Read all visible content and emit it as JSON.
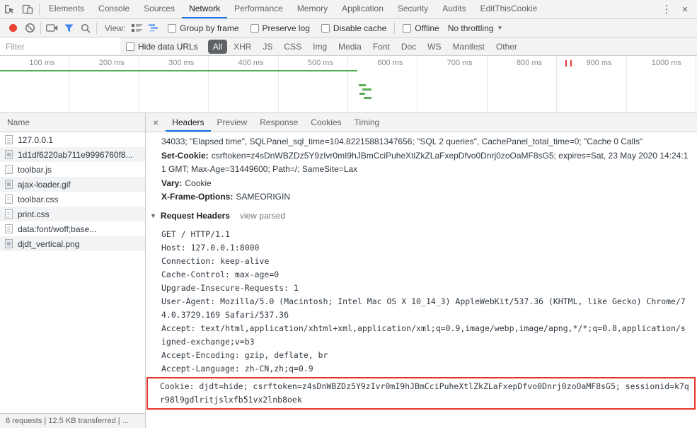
{
  "icons": {
    "more": "⋮",
    "close": "×",
    "caret": "▼",
    "disclosure": "▼",
    "detail_close": "×"
  },
  "colors": {
    "accent_blue": "#1a73e8",
    "record_red": "#ea4335",
    "timeline_green": "#4caf50",
    "highlight_red": "#e5342b"
  },
  "tabbar": {
    "tabs": [
      "Elements",
      "Console",
      "Sources",
      "Network",
      "Performance",
      "Memory",
      "Application",
      "Security",
      "Audits",
      "EditThisCookie"
    ],
    "active": "Network"
  },
  "net_toolbar": {
    "view_label": "View:",
    "group_by_frame": "Group by frame",
    "preserve_log": "Preserve log",
    "disable_cache": "Disable cache",
    "offline": "Offline",
    "throttling": "No throttling"
  },
  "filter_bar": {
    "placeholder": "Filter",
    "hide_data_urls": "Hide data URLs",
    "types": [
      "All",
      "XHR",
      "JS",
      "CSS",
      "Img",
      "Media",
      "Font",
      "Doc",
      "WS",
      "Manifest",
      "Other"
    ],
    "selected_type": "All"
  },
  "timeline": {
    "ticks": [
      "100 ms",
      "200 ms",
      "300 ms",
      "400 ms",
      "500 ms",
      "600 ms",
      "700 ms",
      "800 ms",
      "900 ms",
      "1000 ms"
    ]
  },
  "requests": {
    "name_header": "Name",
    "rows": [
      {
        "name": "127.0.0.1",
        "icon": "document-file-icon"
      },
      {
        "name": "1d1df6220ab711e9996760f8...",
        "icon": "image-file-icon"
      },
      {
        "name": "toolbar.js",
        "icon": "script-file-icon"
      },
      {
        "name": "ajax-loader.gif",
        "icon": "image-file-icon"
      },
      {
        "name": "toolbar.css",
        "icon": "stylesheet-file-icon"
      },
      {
        "name": "print.css",
        "icon": "stylesheet-file-icon"
      },
      {
        "name": "data:font/woff;base...",
        "icon": "font-file-icon"
      },
      {
        "name": "djdt_vertical.png",
        "icon": "image-file-icon"
      }
    ],
    "summary": "8 requests | 12.5 KB transferred | ..."
  },
  "details": {
    "tabs": [
      "Headers",
      "Preview",
      "Response",
      "Cookies",
      "Timing"
    ],
    "active_tab": "Headers",
    "overflow_text": "34033; \"Elapsed time\", SQLPanel_sql_time=104.82215881347656; \"SQL 2 queries\", CachePanel_total_time=0; \"Cache 0 Calls\"",
    "response_headers": [
      {
        "name": "Set-Cookie:",
        "value": "csrftoken=z4sDnWBZDz5Y9zIvr0mI9hJBmCciPuheXtlZkZLaFxepDfvo0Dnrj0zoOaMF8sG5; expires=Sat, 23 May 2020 14:24:11 GMT; Max-Age=31449600; Path=/; SameSite=Lax"
      },
      {
        "name": "Vary:",
        "value": "Cookie"
      },
      {
        "name": "X-Frame-Options:",
        "value": "SAMEORIGIN"
      }
    ],
    "request_headers_title": "Request Headers",
    "view_parsed": "view parsed",
    "raw_lines": [
      "GET / HTTP/1.1",
      "Host: 127.0.0.1:8000",
      "Connection: keep-alive",
      "Cache-Control: max-age=0",
      "Upgrade-Insecure-Requests: 1",
      "User-Agent: Mozilla/5.0 (Macintosh; Intel Mac OS X 10_14_3) AppleWebKit/537.36 (KHTML, like Gecko) Chrome/74.0.3729.169 Safari/537.36",
      "Accept: text/html,application/xhtml+xml,application/xml;q=0.9,image/webp,image/apng,*/*;q=0.8,application/signed-exchange;v=b3",
      "Accept-Encoding: gzip, deflate, br",
      "Accept-Language: zh-CN,zh;q=0.9"
    ],
    "cookie_line": "Cookie: djdt=hide; csrftoken=z4sDnWBZDz5Y9zIvr0mI9hJBmCciPuheXtlZkZLaFxepDfvo0Dnrj0zoOaMF8sG5; sessionid=k7qr98l9gdlritjslxfb51vx2lnb8oek"
  }
}
